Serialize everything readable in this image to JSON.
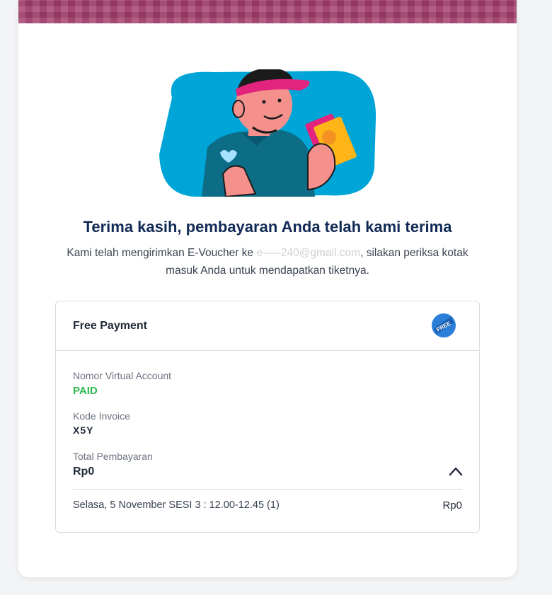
{
  "header": {
    "title": "Terima kasih, pembayaran Anda telah kami terima",
    "subtitle_before": "Kami telah mengirimkan E-Voucher ke ",
    "email_masked": "e‒‒‒240@gmail.com",
    "subtitle_after": ", silakan periksa kotak masuk Anda untuk mendapatkan tiketnya."
  },
  "payment": {
    "method_title": "Free Payment",
    "badge_icon": "free-badge-icon",
    "badge_text": "FREE",
    "va_label": "Nomor Virtual Account",
    "va_value": "PAID",
    "invoice_label": "Kode Invoice",
    "invoice_value_masked": "X5Y",
    "total_label": "Total Pembayaran",
    "total_value": "Rp0",
    "session_text": "Selasa, 5 November SESI 3 : 12.00-12.45 (1)",
    "session_amount": "Rp0",
    "accent_paid_color": "#2fb84f",
    "title_color": "#122a55"
  }
}
